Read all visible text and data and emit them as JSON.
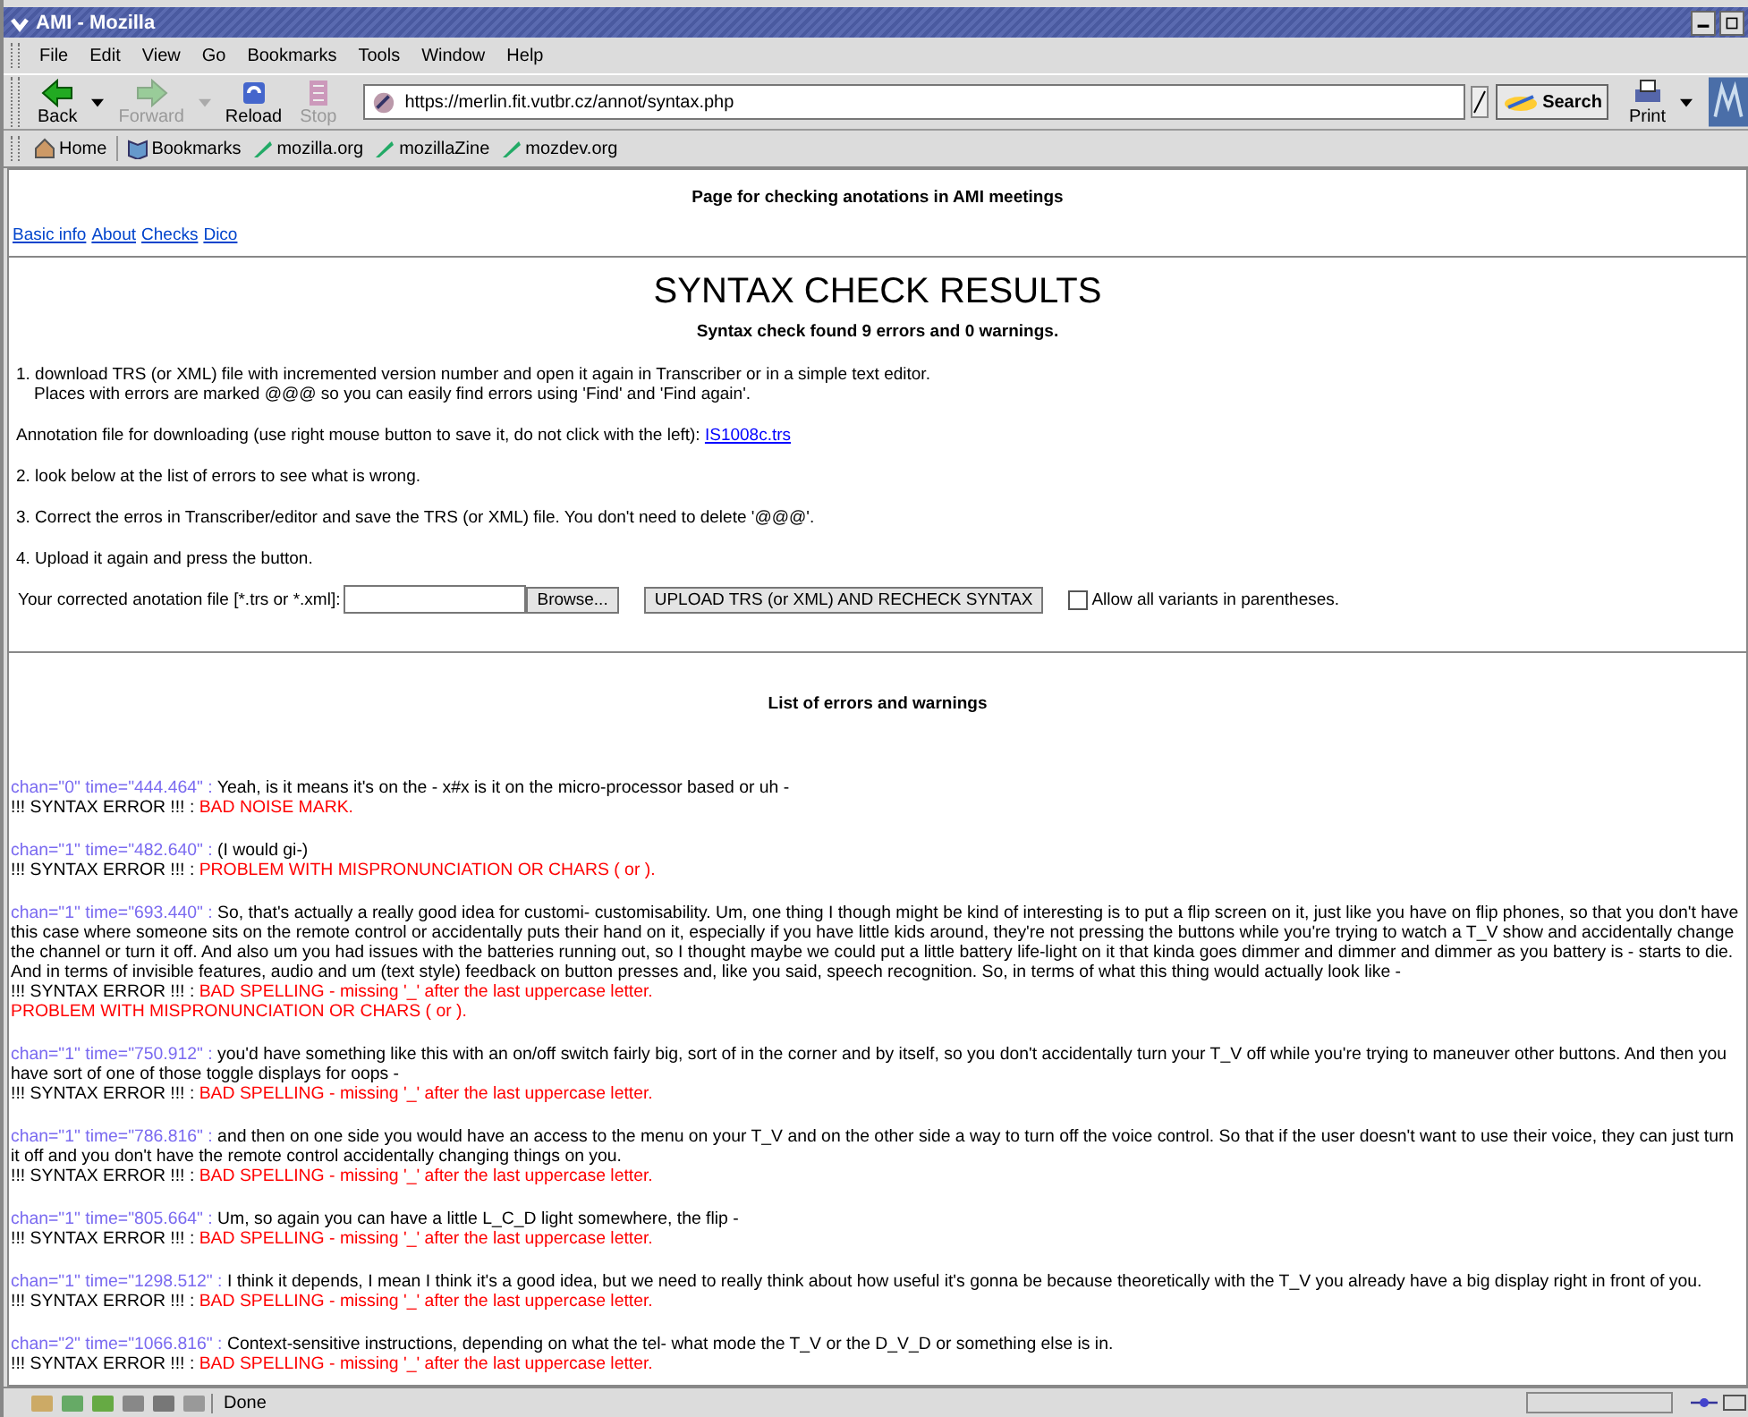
{
  "window": {
    "title": "AMI - Mozilla"
  },
  "menu": [
    "File",
    "Edit",
    "View",
    "Go",
    "Bookmarks",
    "Tools",
    "Window",
    "Help"
  ],
  "nav_buttons": [
    {
      "label": "Back",
      "disabled": false,
      "dropdown": true
    },
    {
      "label": "Forward",
      "disabled": true,
      "dropdown": true
    },
    {
      "label": "Reload",
      "disabled": false,
      "dropdown": false
    },
    {
      "label": "Stop",
      "disabled": true,
      "dropdown": false
    }
  ],
  "address": "https://merlin.fit.vutbr.cz/annot/syntax.php",
  "search_button": "Search",
  "print_button": "Print",
  "bookmarks": [
    "Home",
    "Bookmarks",
    "mozilla.org",
    "mozillaZine",
    "mozdev.org"
  ],
  "page": {
    "header": "Page for checking anotations in AMI meetings",
    "links": [
      "Basic info",
      "About",
      "Checks",
      "Dico"
    ],
    "title": "SYNTAX CHECK RESULTS",
    "summary": "Syntax check found 9 errors and 0 warnings.",
    "step_1": "1. download TRS (or XML) file with incremented version number and open it again in Transcriber or in a simple text editor.",
    "step_1_note": "Places with errors are marked @@@ so you can easily find errors using 'Find' and 'Find again'.",
    "download_text": "Annotation file for downloading (use right mouse button to save it, do not click with the left):",
    "download_link": "IS1008c.trs",
    "step_2": "2. look below at the list of errors to see what is wrong.",
    "step_3": "3. Correct the erros in Transcriber/editor and save the TRS (or XML) file. You don't need to delete '@@@'.",
    "step_4": "4. Upload it again and press the button.",
    "upload_label": "Your corrected anotation file [*.trs or *.xml]:",
    "browse_button": "Browse...",
    "upload_button": "UPLOAD TRS (or XML) AND RECHECK SYNTAX",
    "allow_variants": {
      "label": "Allow all variants in parentheses.",
      "checked": false
    },
    "list_title": "List of errors and warnings",
    "entries": [
      {
        "ref": "chan=\"0\" time=\"444.464\" :",
        "text": "Yeah, is it means it's on the - x#x is it on the micro-processor based or uh -",
        "label": "!!! SYNTAX ERROR !!! :",
        "errors": [
          "BAD NOISE MARK."
        ]
      },
      {
        "ref": "chan=\"1\" time=\"482.640\" :",
        "text": "(I would gi-)",
        "label": "!!! SYNTAX ERROR !!! :",
        "errors": [
          "PROBLEM WITH MISPRONUNCIATION OR CHARS ( or )."
        ]
      },
      {
        "ref": "chan=\"1\" time=\"693.440\" :",
        "text": "So, that's actually a really good idea for customi- customisability. Um, one thing I though might be kind of interesting is to put a flip screen on it, just like you have on flip phones, so that you don't have this case where someone sits on the remote control or accidentally puts their hand on it, especially if you have little kids around, they're not pressing the buttons while you're trying to watch a T_V show and accidentally change the channel or turn it off. And also um you had issues with the batteries running out, so I thought maybe we could put a little battery life-light on it that kinda goes dimmer and dimmer and dimmer as you battery is - starts to die. And in terms of invisible features, audio and um (text style) feedback on button presses and, like you said, speech recognition. So, in terms of what this thing would actually look like -",
        "label": "!!! SYNTAX ERROR !!! :",
        "errors": [
          "BAD SPELLING - missing '_' after the last uppercase letter.",
          "PROBLEM WITH MISPRONUNCIATION OR CHARS ( or )."
        ]
      },
      {
        "ref": "chan=\"1\" time=\"750.912\" :",
        "text": "you'd have something like this with an on/off switch fairly big, sort of in the corner and by itself, so you don't accidentally turn your T_V off while you're trying to maneuver other buttons. And then you have sort of one of those toggle displays for oops -",
        "label": "!!! SYNTAX ERROR !!! :",
        "errors": [
          "BAD SPELLING - missing '_' after the last uppercase letter."
        ]
      },
      {
        "ref": "chan=\"1\" time=\"786.816\" :",
        "text": "and then on one side you would have an access to the menu on your T_V and on the other side a way to turn off the voice control. So that if the user doesn't want to use their voice, they can just turn it off and you don't have the remote control accidentally changing things on you.",
        "label": "!!! SYNTAX ERROR !!! :",
        "errors": [
          "BAD SPELLING - missing '_' after the last uppercase letter."
        ]
      },
      {
        "ref": "chan=\"1\" time=\"805.664\" :",
        "text": "Um, so again you can have a little L_C_D light somewhere, the flip -",
        "label": "!!! SYNTAX ERROR !!! :",
        "errors": [
          "BAD SPELLING - missing '_' after the last uppercase letter."
        ]
      },
      {
        "ref": "chan=\"1\" time=\"1298.512\" :",
        "text": "I think it depends, I mean I think it's a good idea, but we need to really think about how useful it's gonna be because theoretically with the T_V you already have a big display right in front of you.",
        "label": "!!! SYNTAX ERROR !!! :",
        "errors": [
          "BAD SPELLING - missing '_' after the last uppercase letter."
        ]
      },
      {
        "ref": "chan=\"2\" time=\"1066.816\" :",
        "text": "Context-sensitive instructions, depending on what the tel- what mode the T_V or the D_V_D or something else is in.",
        "label": "!!! SYNTAX ERROR !!! :",
        "errors": [
          "BAD SPELLING - missing '_' after the last uppercase letter."
        ]
      }
    ]
  },
  "status": "Done"
}
